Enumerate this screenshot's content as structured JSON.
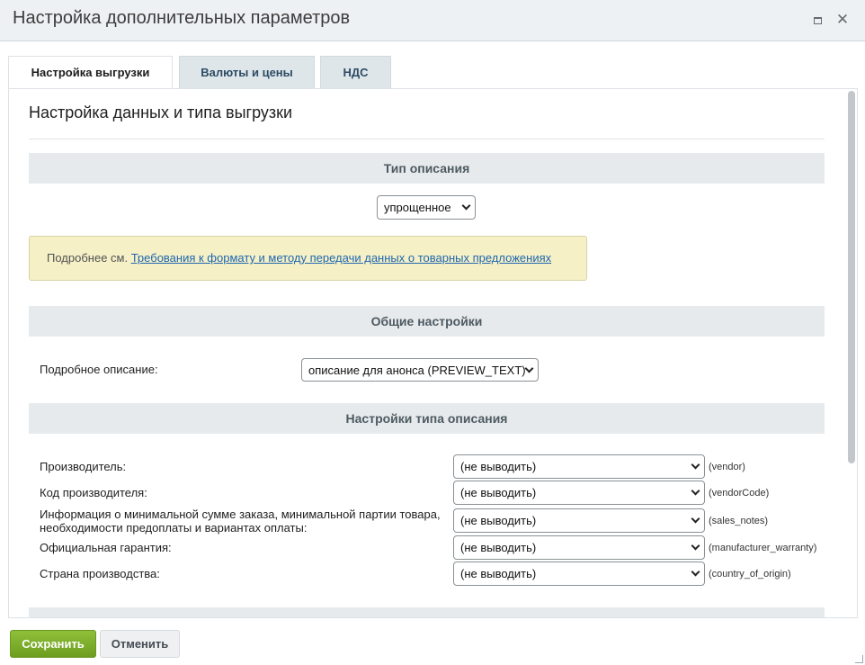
{
  "window": {
    "title": "Настройка дополнительных параметров"
  },
  "tabs": [
    {
      "label": "Настройка выгрузки",
      "active": true
    },
    {
      "label": "Валюты и цены",
      "active": false
    },
    {
      "label": "НДС",
      "active": false
    }
  ],
  "content": {
    "title": "Настройка данных и типа выгрузки",
    "sections": {
      "description_type": "Тип описания",
      "general": "Общие настройки",
      "type_settings": "Настройки типа описания"
    },
    "description_type_select": {
      "value": "упрощенное"
    },
    "note": {
      "prefix": "Подробнее см.",
      "link_text": "Требования к формату и методу передачи данных о товарных предложениях"
    },
    "general": {
      "label": "Подробное описание:",
      "value": "описание для анонса (PREVIEW_TEXT)"
    },
    "type_rows": [
      {
        "label": "Производитель:",
        "value": "(не выводить)",
        "code": "(vendor)"
      },
      {
        "label": "Код производителя:",
        "value": "(не выводить)",
        "code": "(vendorCode)"
      },
      {
        "label_line1": "Информация о минимальной сумме заказа, минимальной партии товара,",
        "label_line2": "необходимости предоплаты и вариантах оплаты:",
        "value": "(не выводить)",
        "code": "(sales_notes)"
      },
      {
        "label": "Официальная гарантия:",
        "value": "(не выводить)",
        "code": "(manufacturer_warranty)"
      },
      {
        "label": "Страна производства:",
        "value": "(не выводить)",
        "code": "(country_of_origin)"
      }
    ]
  },
  "footer": {
    "save_label": "Сохранить",
    "cancel_label": "Отменить"
  },
  "colors": {
    "save_button": "#7aab2a",
    "section_bar": "#e7eaec",
    "note_background": "#f5f0c6",
    "link": "#2067b0"
  },
  "icons": [
    "maximize-icon",
    "close-icon",
    "chevron-down-icon",
    "resize-grip-icon"
  ]
}
